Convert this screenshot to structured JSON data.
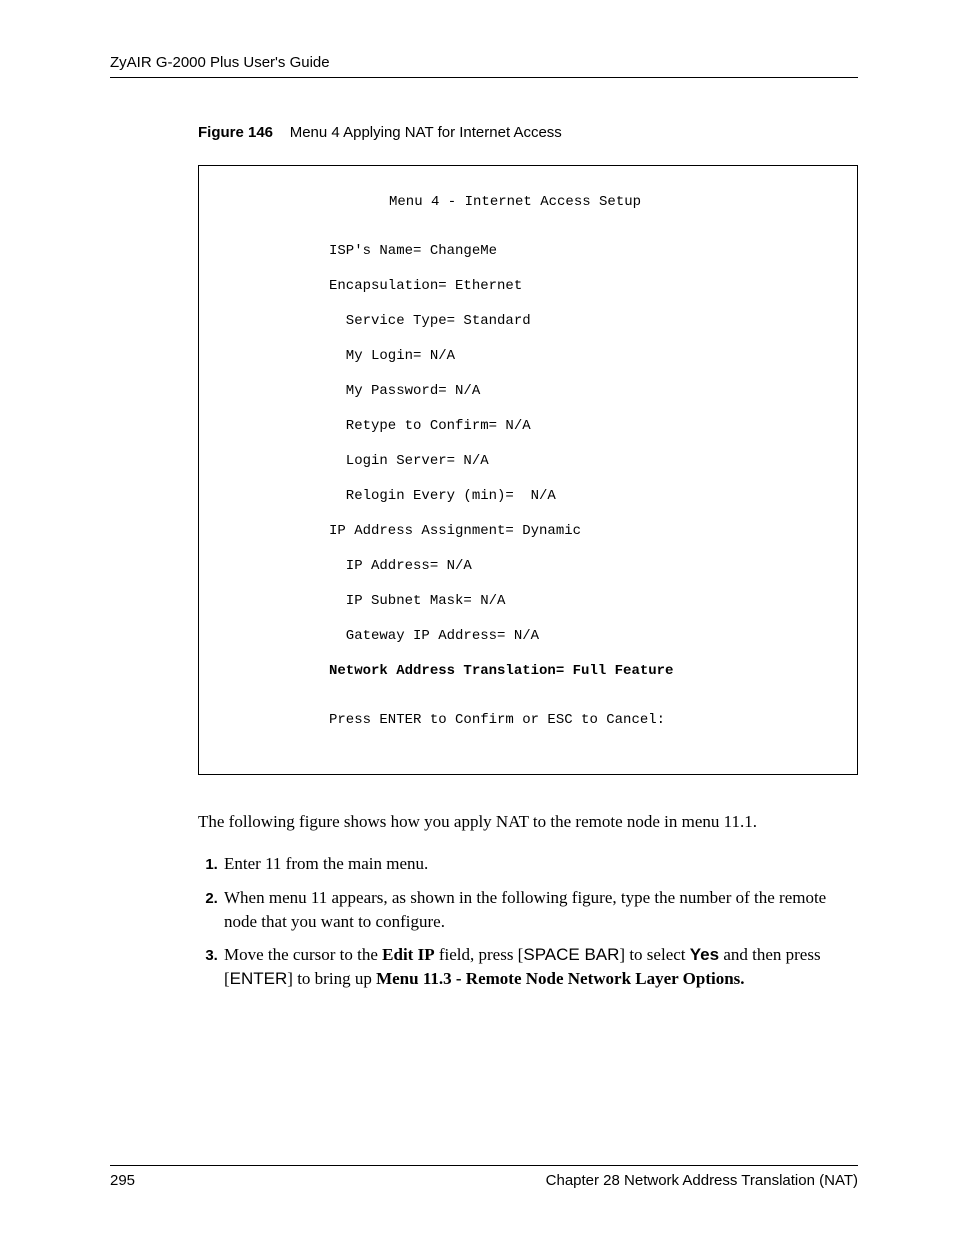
{
  "header": {
    "left": "ZyAIR G-2000 Plus User's Guide"
  },
  "figure": {
    "label": "Figure 146",
    "caption": "Menu 4 Applying NAT for Internet Access"
  },
  "terminal": {
    "title": "Menu 4 - Internet Access Setup",
    "lines": [
      "ISP's Name= ChangeMe",
      "Encapsulation= Ethernet",
      "  Service Type= Standard",
      "  My Login= N/A",
      "  My Password= N/A",
      "  Retype to Confirm= N/A",
      "  Login Server= N/A",
      "  Relogin Every (min)=  N/A",
      "IP Address Assignment= Dynamic",
      "  IP Address= N/A",
      "  IP Subnet Mask= N/A",
      "  Gateway IP Address= N/A"
    ],
    "bold_line": "Network Address Translation= Full Feature",
    "footer": "Press ENTER to Confirm or ESC to Cancel:"
  },
  "paragraph": "The following figure shows how you apply NAT to the remote node in menu 11.1.",
  "steps": {
    "1": "Enter 11 from the main menu.",
    "2": "When menu 11 appears, as shown in the following figure, type the number of the remote node that you want to configure.",
    "3": {
      "a": "Move the cursor to the ",
      "b": "Edit IP",
      "c": " field, press [",
      "d": "SPACE BAR",
      "e": "] to select ",
      "f": "Yes",
      "g": " and then press [",
      "h": "ENTER",
      "i": "] to bring up ",
      "j": "Menu 11.3 - Remote Node Network Layer Options."
    }
  },
  "footer": {
    "page": "295",
    "chapter": "Chapter 28 Network Address Translation (NAT)"
  }
}
